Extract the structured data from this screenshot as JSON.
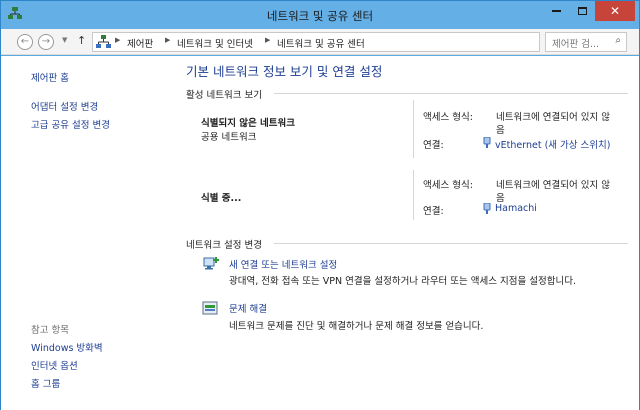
{
  "window": {
    "title": "네트워크 및 공유 센터",
    "close_glyph": "✕"
  },
  "nav": {
    "back_glyph": "←",
    "forward_glyph": "→",
    "up_glyph": "↑",
    "breadcrumbs": [
      "제어판",
      "네트워크 및 인터넷",
      "네트워크 및 공유 센터"
    ],
    "refresh_glyph": "↻",
    "search_placeholder": "제어판 검...",
    "search_glyph": "⌕"
  },
  "sidebar": {
    "home_link": "제어판 홈",
    "links": [
      "어댑터 설정 변경",
      "고급 공유 설정 변경"
    ],
    "see_also_heading": "참고 항목",
    "see_also": [
      "Windows 방화벽",
      "인터넷 옵션",
      "홈 그룹"
    ]
  },
  "main": {
    "title": "기본 네트워크 정보 보기 및 연결 설정",
    "active_networks_label": "활성 네트워크 보기",
    "networks": [
      {
        "name": "식별되지 않은 네트워크",
        "type": "공용 네트워크",
        "access_label": "액세스 형식:",
        "access_value_line1": "네트워크에 연결되어 있지 않",
        "access_value_line2": "음",
        "connection_label": "연결:",
        "connection_value": "vEthernet (새 가상 스위치)"
      },
      {
        "name": "식별 중...",
        "type": "",
        "access_label": "액세스 형식:",
        "access_value_line1": "네트워크에 연결되어 있지 않",
        "access_value_line2": "음",
        "connection_label": "연결:",
        "connection_value": "Hamachi"
      }
    ],
    "change_settings_label": "네트워크 설정 변경",
    "tasks": [
      {
        "link": "새 연결 또는 네트워크 설정",
        "description": "광대역, 전화 접속 또는 VPN 연결을 설정하거나 라우터 또는 액세스 지점을 설정합니다.",
        "icon": "new-connection-icon"
      },
      {
        "link": "문제 해결",
        "description": "네트워크 문제를 진단 및 해결하거나 문제 해결 정보를 얻습니다.",
        "icon": "troubleshoot-icon"
      }
    ]
  },
  "colors": {
    "link": "#1e3e92",
    "titlebar": "#63afe6",
    "close": "#c7443a"
  }
}
